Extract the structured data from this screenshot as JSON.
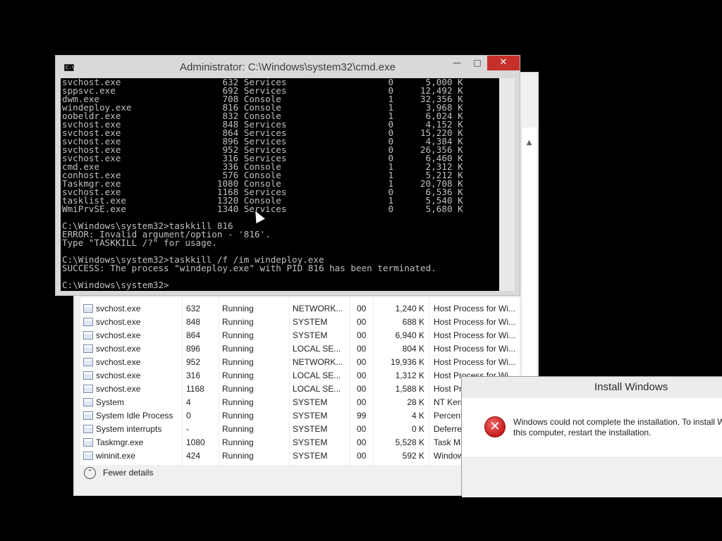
{
  "task_manager": {
    "rows": [
      {
        "name": "svchost.exe",
        "pid": "632",
        "status": "Running",
        "user": "NETWORK...",
        "cpu": "00",
        "memory": "1,240 K",
        "desc": "Host Process for Wi..."
      },
      {
        "name": "svchost.exe",
        "pid": "848",
        "status": "Running",
        "user": "SYSTEM",
        "cpu": "00",
        "memory": "688 K",
        "desc": "Host Process for Wi..."
      },
      {
        "name": "svchost.exe",
        "pid": "864",
        "status": "Running",
        "user": "SYSTEM",
        "cpu": "00",
        "memory": "6,940 K",
        "desc": "Host Process for Wi..."
      },
      {
        "name": "svchost.exe",
        "pid": "896",
        "status": "Running",
        "user": "LOCAL SE...",
        "cpu": "00",
        "memory": "804 K",
        "desc": "Host Process for Wi..."
      },
      {
        "name": "svchost.exe",
        "pid": "952",
        "status": "Running",
        "user": "NETWORK...",
        "cpu": "00",
        "memory": "19,936 K",
        "desc": "Host Process for Wi..."
      },
      {
        "name": "svchost.exe",
        "pid": "316",
        "status": "Running",
        "user": "LOCAL SE...",
        "cpu": "00",
        "memory": "1,312 K",
        "desc": "Host Process for Wi..."
      },
      {
        "name": "svchost.exe",
        "pid": "1168",
        "status": "Running",
        "user": "LOCAL SE...",
        "cpu": "00",
        "memory": "1,588 K",
        "desc": "Host Pr"
      },
      {
        "name": "System",
        "pid": "4",
        "status": "Running",
        "user": "SYSTEM",
        "cpu": "00",
        "memory": "28 K",
        "desc": "NT Kern"
      },
      {
        "name": "System Idle Process",
        "pid": "0",
        "status": "Running",
        "user": "SYSTEM",
        "cpu": "99",
        "memory": "4 K",
        "desc": "Percent"
      },
      {
        "name": "System interrupts",
        "pid": "-",
        "status": "Running",
        "user": "SYSTEM",
        "cpu": "00",
        "memory": "0 K",
        "desc": "Deferre"
      },
      {
        "name": "Taskmgr.exe",
        "pid": "1080",
        "status": "Running",
        "user": "SYSTEM",
        "cpu": "00",
        "memory": "5,528 K",
        "desc": "Task Ma"
      },
      {
        "name": "wininit.exe",
        "pid": "424",
        "status": "Running",
        "user": "SYSTEM",
        "cpu": "00",
        "memory": "592 K",
        "desc": "Window"
      }
    ],
    "fewer_details_label": "Fewer details",
    "scroll_up_glyph": "▲"
  },
  "cmd": {
    "title": "Administrator: C:\\Windows\\system32\\cmd.exe",
    "icon_text": "C:\\",
    "buttons": {
      "minimize": "—",
      "maximize": "□",
      "close": "✕"
    },
    "process_rows": [
      {
        "name": "svchost.exe",
        "pid": "632",
        "session": "Services",
        "num": "0",
        "mem": "5,000 K"
      },
      {
        "name": "sppsvc.exe",
        "pid": "692",
        "session": "Services",
        "num": "0",
        "mem": "12,492 K"
      },
      {
        "name": "dwm.exe",
        "pid": "708",
        "session": "Console",
        "num": "1",
        "mem": "32,356 K"
      },
      {
        "name": "windeploy.exe",
        "pid": "816",
        "session": "Console",
        "num": "1",
        "mem": "3,968 K"
      },
      {
        "name": "oobeldr.exe",
        "pid": "832",
        "session": "Console",
        "num": "1",
        "mem": "6,024 K"
      },
      {
        "name": "svchost.exe",
        "pid": "848",
        "session": "Services",
        "num": "0",
        "mem": "4,152 K"
      },
      {
        "name": "svchost.exe",
        "pid": "864",
        "session": "Services",
        "num": "0",
        "mem": "15,220 K"
      },
      {
        "name": "svchost.exe",
        "pid": "896",
        "session": "Services",
        "num": "0",
        "mem": "4,384 K"
      },
      {
        "name": "svchost.exe",
        "pid": "952",
        "session": "Services",
        "num": "0",
        "mem": "26,356 K"
      },
      {
        "name": "svchost.exe",
        "pid": "316",
        "session": "Services",
        "num": "0",
        "mem": "6,460 K"
      },
      {
        "name": "cmd.exe",
        "pid": "336",
        "session": "Console",
        "num": "1",
        "mem": "2,312 K"
      },
      {
        "name": "conhost.exe",
        "pid": "576",
        "session": "Console",
        "num": "1",
        "mem": "5,212 K"
      },
      {
        "name": "Taskmgr.exe",
        "pid": "1080",
        "session": "Console",
        "num": "1",
        "mem": "20,708 K"
      },
      {
        "name": "svchost.exe",
        "pid": "1168",
        "session": "Services",
        "num": "0",
        "mem": "6,536 K"
      },
      {
        "name": "tasklist.exe",
        "pid": "1320",
        "session": "Console",
        "num": "1",
        "mem": "5,540 K"
      },
      {
        "name": "WmiPrvSE.exe",
        "pid": "1340",
        "session": "Services",
        "num": "0",
        "mem": "5,680 K"
      }
    ],
    "output_lines": [
      "",
      "C:\\Windows\\system32>taskkill 816",
      "ERROR: Invalid argument/option - '816'.",
      "Type \"TASKKILL /?\" for usage.",
      "",
      "C:\\Windows\\system32>taskkill /f /im windeploy.exe",
      "SUCCESS: The process \"windeploy.exe\" with PID 816 has been terminated.",
      "",
      "C:\\Windows\\system32>"
    ]
  },
  "install_dialog": {
    "title": "Install Windows",
    "message_line1": "Windows could not complete the installation. To install W",
    "message_line2": "this computer, restart the installation.",
    "icon_glyph": "✕"
  }
}
